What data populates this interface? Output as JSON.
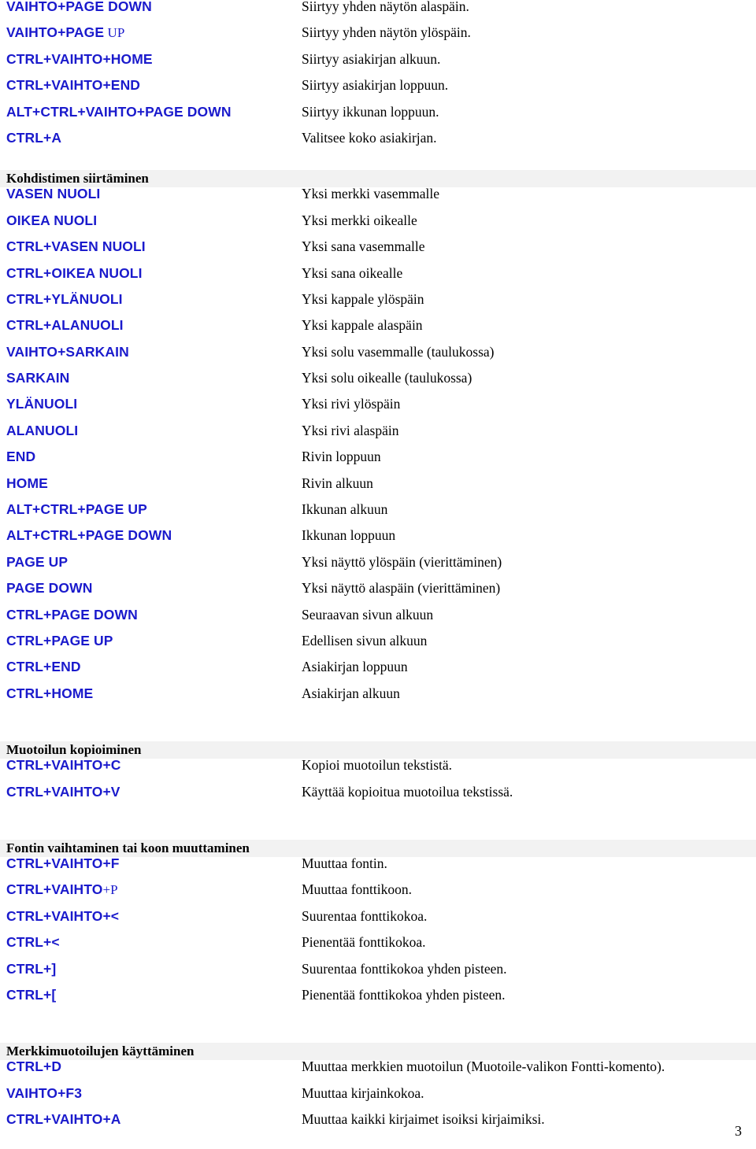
{
  "document": {
    "language": "fi",
    "page_number": "3",
    "accent_color": "#1a1acc",
    "section_band_color": "#f2f2f2"
  },
  "sections": [
    {
      "id": "continued-top",
      "heading": null,
      "rows": [
        {
          "keys": "VAIHTO+PAGE DOWN",
          "desc": "Siirtyy yhden näytön alaspäin."
        },
        {
          "keys": "VAIHTO+PAGE UP",
          "keys_bold": "VAIHTO+PAGE",
          "keys_tail": " UP",
          "desc": "Siirtyy yhden näytön ylöspäin."
        },
        {
          "keys": "CTRL+VAIHTO+HOME",
          "desc": "Siirtyy asiakirjan alkuun."
        },
        {
          "keys": "CTRL+VAIHTO+END",
          "desc": "Siirtyy asiakirjan loppuun."
        },
        {
          "keys": "ALT+CTRL+VAIHTO+PAGE DOWN",
          "desc": "Siirtyy ikkunan loppuun."
        },
        {
          "keys": "CTRL+A",
          "desc": "Valitsee koko asiakirjan."
        }
      ]
    },
    {
      "id": "kohdistimen-siirtaminen",
      "heading": "Kohdistimen siirtäminen",
      "rows": [
        {
          "keys": "VASEN NUOLI",
          "desc": "Yksi merkki vasemmalle"
        },
        {
          "keys": "OIKEA NUOLI",
          "desc": "Yksi merkki oikealle"
        },
        {
          "keys": "CTRL+VASEN NUOLI",
          "desc": "Yksi sana vasemmalle"
        },
        {
          "keys": "CTRL+OIKEA NUOLI",
          "desc": "Yksi sana oikealle"
        },
        {
          "keys": "CTRL+YLÄNUOLI",
          "desc": "Yksi kappale ylöspäin"
        },
        {
          "keys": "CTRL+ALANUOLI",
          "desc": "Yksi kappale alaspäin"
        },
        {
          "keys": "VAIHTO+SARKAIN",
          "desc": "Yksi solu vasemmalle (taulukossa)"
        },
        {
          "keys": "SARKAIN",
          "desc": "Yksi solu oikealle (taulukossa)"
        },
        {
          "keys": "YLÄNUOLI",
          "desc": "Yksi rivi ylöspäin"
        },
        {
          "keys": "ALANUOLI",
          "desc": "Yksi rivi alaspäin"
        },
        {
          "keys": "END",
          "desc": "Rivin loppuun"
        },
        {
          "keys": "HOME",
          "desc": "Rivin alkuun"
        },
        {
          "keys": "ALT+CTRL+PAGE UP",
          "desc": "Ikkunan alkuun"
        },
        {
          "keys": "ALT+CTRL+PAGE DOWN",
          "desc": "Ikkunan loppuun"
        },
        {
          "keys": "PAGE UP",
          "desc": "Yksi näyttö ylöspäin (vierittäminen)"
        },
        {
          "keys": "PAGE DOWN",
          "desc": "Yksi näyttö alaspäin (vierittäminen)"
        },
        {
          "keys": "CTRL+PAGE DOWN",
          "desc": "Seuraavan sivun alkuun"
        },
        {
          "keys": "CTRL+PAGE UP",
          "desc": "Edellisen sivun alkuun"
        },
        {
          "keys": "CTRL+END",
          "desc": "Asiakirjan loppuun"
        },
        {
          "keys": "CTRL+HOME",
          "desc": "Asiakirjan alkuun"
        }
      ]
    },
    {
      "id": "muotoilun-kopioiminen",
      "heading": "Muotoilun kopioiminen",
      "rows": [
        {
          "keys": "CTRL+VAIHTO+C",
          "desc": "Kopioi muotoilun tekstistä."
        },
        {
          "keys": "CTRL+VAIHTO+V",
          "desc": "Käyttää kopioitua muotoilua tekstissä."
        }
      ]
    },
    {
      "id": "fontin-vaihtaminen",
      "heading": "Fontin vaihtaminen tai koon muuttaminen",
      "rows": [
        {
          "keys": "CTRL+VAIHTO+F",
          "desc": "Muuttaa fontin."
        },
        {
          "keys": "CTRL+VAIHTO+P",
          "keys_bold": "CTRL+VAIHTO",
          "keys_tail": "+P",
          "desc": "Muuttaa fonttikoon."
        },
        {
          "keys": "CTRL+VAIHTO+<",
          "desc": "Suurentaa fonttikokoa."
        },
        {
          "keys": "CTRL+<",
          "desc": "Pienentää fonttikokoa."
        },
        {
          "keys": "CTRL+]",
          "desc": "Suurentaa fonttikokoa yhden pisteen."
        },
        {
          "keys": "CTRL+[",
          "desc": "Pienentää fonttikokoa yhden pisteen."
        }
      ]
    },
    {
      "id": "merkkimuotoilujen-kayttaminen",
      "heading": "Merkkimuotoilujen käyttäminen",
      "rows": [
        {
          "keys": "CTRL+D",
          "desc": "Muuttaa merkkien muotoilun (Muotoile-valikon Fontti-komento)."
        },
        {
          "keys": "VAIHTO+F3",
          "desc": "Muuttaa kirjainkokoa."
        },
        {
          "keys": "CTRL+VAIHTO+A",
          "desc": "Muuttaa kaikki kirjaimet isoiksi kirjaimiksi."
        }
      ]
    }
  ]
}
